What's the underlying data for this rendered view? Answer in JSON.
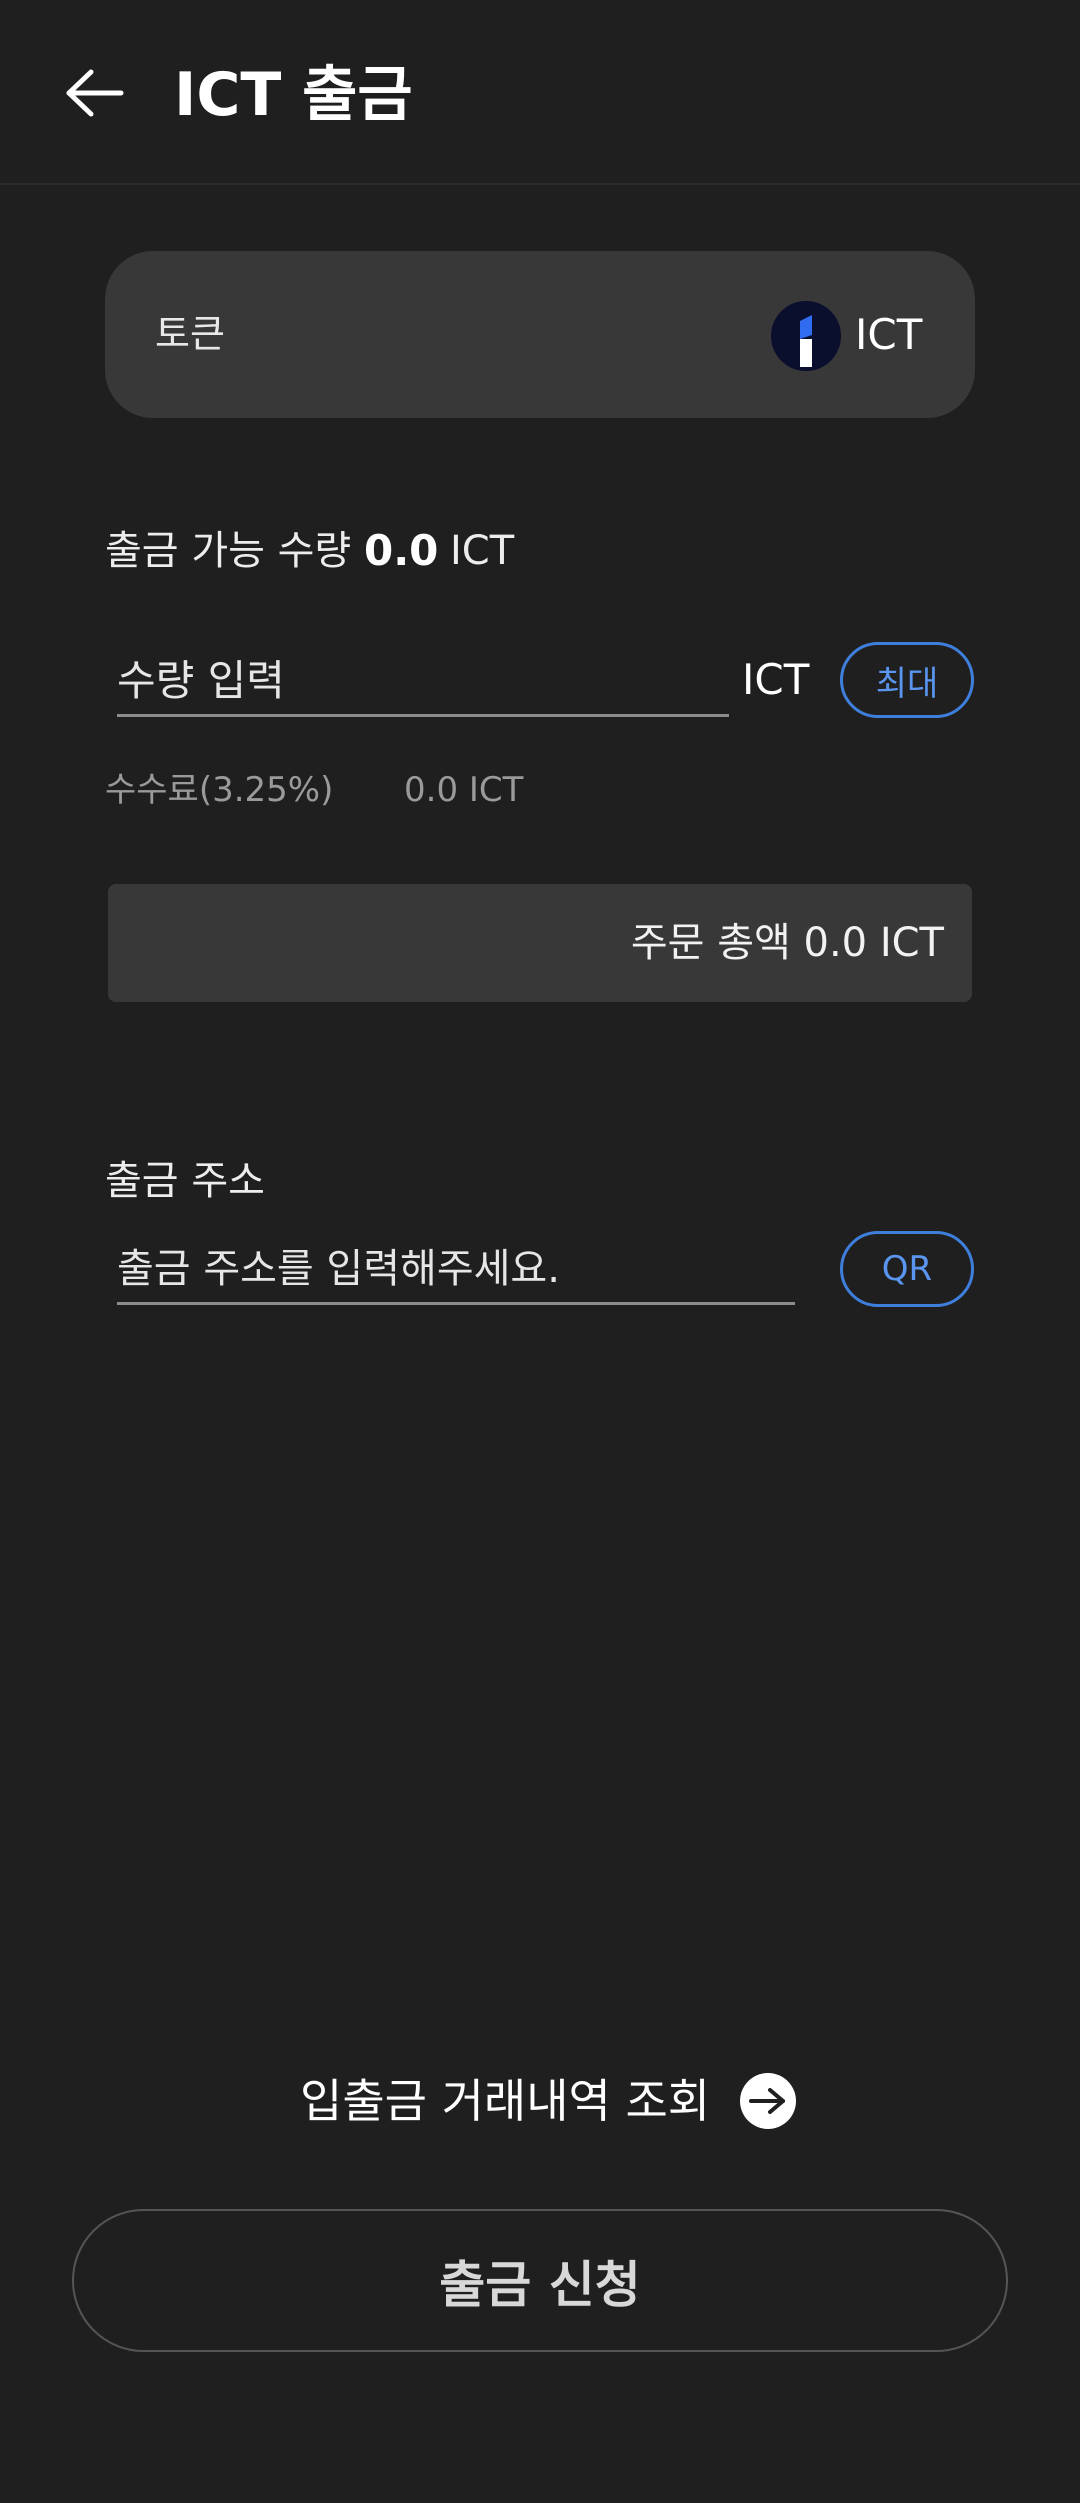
{
  "header": {
    "back_icon": "arrow-left-icon",
    "title": "ICT 출금"
  },
  "token_selector": {
    "label": "토큰",
    "token_icon": "ict-token-logo",
    "token_name": "ICT"
  },
  "available": {
    "label": "출금 가능 수량",
    "value": "0.0",
    "unit": "ICT"
  },
  "amount": {
    "placeholder": "수량 입력",
    "value": "",
    "unit": "ICT",
    "max_label": "최대"
  },
  "fee": {
    "label": "수수료(3.25%)",
    "value": "0.0 ICT"
  },
  "total": {
    "text": "주문 총액 0.0 ICT"
  },
  "address": {
    "label": "출금 주소",
    "placeholder": "출금 주소를 입력해주세요.",
    "value": "",
    "qr_label": "QR"
  },
  "history": {
    "label": "입출금 거래내역 조회",
    "icon": "arrow-right-circle-icon"
  },
  "submit": {
    "label": "출금 신청"
  },
  "colors": {
    "background": "#1f1f1f",
    "card": "#383838",
    "accent_blue": "#3f7fdc",
    "text_muted": "#9a9a9a"
  }
}
